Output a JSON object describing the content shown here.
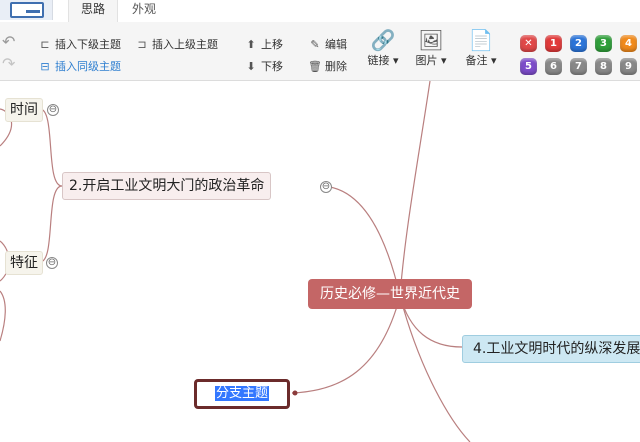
{
  "tabs": [
    {
      "label": "思路"
    },
    {
      "label": "外观"
    }
  ],
  "toolbar": {
    "insert_child": "插入下级主题",
    "insert_parent": "插入上级主题",
    "insert_sibling": "插入同级主题",
    "move_up": "上移",
    "move_down": "下移",
    "edit": "编辑",
    "delete": "删除",
    "link": "链接",
    "image": "图片",
    "note": "备注",
    "dropdown_arrow": "▾",
    "priorities": [
      {
        "label": "✕",
        "color": "#e04848"
      },
      {
        "label": "1",
        "color": "#e03a3a"
      },
      {
        "label": "2",
        "color": "#2b74d8"
      },
      {
        "label": "3",
        "color": "#2f9e3a"
      },
      {
        "label": "4",
        "color": "#f08a1c"
      },
      {
        "label": "5",
        "color": "#7c4cc9"
      },
      {
        "label": "6",
        "color": "#888888"
      },
      {
        "label": "7",
        "color": "#888888"
      },
      {
        "label": "8",
        "color": "#888888"
      },
      {
        "label": "9",
        "color": "#888888"
      }
    ]
  },
  "mindmap": {
    "root": "历史必修—世界近代史",
    "topics": [
      {
        "label": "2.开启工业文明大门的政治革命"
      },
      {
        "label": "4.工业文明时代的纵深发展"
      }
    ],
    "side_nodes": [
      {
        "label": "时间"
      },
      {
        "label": "特征"
      }
    ],
    "new_topic": "分支主题",
    "collapse_symbol": "⊖",
    "colors": {
      "root": "#c46666",
      "link": "#b97f7f",
      "selected_border": "#6b2b2b"
    }
  }
}
